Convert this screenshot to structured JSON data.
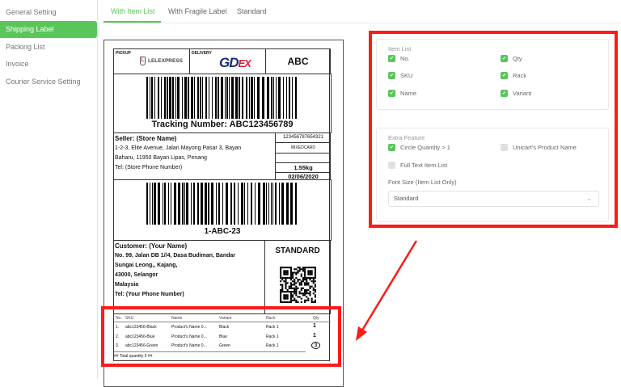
{
  "sidebar": {
    "items": [
      {
        "label": "General Setting"
      },
      {
        "label": "Shipping Label",
        "active": true
      },
      {
        "label": "Packing List"
      },
      {
        "label": "Invoice"
      },
      {
        "label": "Courier Service Setting"
      }
    ]
  },
  "tabs": [
    {
      "label": "With Item List",
      "active": true
    },
    {
      "label": "With Fragile Label"
    },
    {
      "label": "Standard"
    }
  ],
  "label": {
    "pickup_caption": "PICKUP",
    "pickup_logo": "LELEXPRESS",
    "delivery_caption": "DELIVERY",
    "delivery_logo": "GDEX",
    "code": "ABC",
    "tracking": "Tracking Number: ABC123456789",
    "seller": {
      "title": "Seller: (Store Name)",
      "line1": "1-2-3, Elite Avenue, Jalan Mayong Pasar 3, Bayan",
      "line2": "Baharu, 11950 Bayan Lipas, Penang",
      "tel": "Tel: (Store Phone Number)"
    },
    "side": {
      "number": "123456787654321",
      "type": "MIXEDCARD",
      "blank": "",
      "weight": "1.55kg",
      "date": "02/06/2020"
    },
    "sort_code": "1-ABC-23",
    "customer": {
      "title": "Customer: (Your Name)",
      "line1": "No. 99, Jalan DB 1//4, Dasa Budiman, Bandar",
      "line2": "Sungai Leong,, Kajang,",
      "line3": "43000, Selangor",
      "line4": "Malaysia",
      "tel": "Tel: (Your Phone Number)"
    },
    "service": "STANDARD",
    "items": {
      "headers": [
        "No.",
        "SKU",
        "Name",
        "Variant",
        "Rack",
        "Qty"
      ],
      "rows": [
        [
          "1.",
          "abc123456-Black",
          "Product's Name 0...",
          "Black",
          "Rack 1",
          "1"
        ],
        [
          "2.",
          "abc123456-Blue",
          "Product's Name 0...",
          "Blue",
          "Rack 1",
          "1"
        ],
        [
          "3.",
          "abc123456-Green",
          "Product's Name 0...",
          "Green",
          "Rack 1",
          "3"
        ]
      ],
      "total": "## Total quantity 5 ##"
    }
  },
  "settings": {
    "item_list": {
      "title": "Item List",
      "options": [
        {
          "label": "No.",
          "checked": true
        },
        {
          "label": "Qty",
          "checked": true
        },
        {
          "label": "SKU",
          "checked": true
        },
        {
          "label": "Rack",
          "checked": true
        },
        {
          "label": "Name",
          "checked": true
        },
        {
          "label": "Variant",
          "checked": true
        }
      ]
    },
    "extra": {
      "title": "Extra Feature",
      "options": [
        {
          "label": "Circle Quantity > 1",
          "checked": true
        },
        {
          "label": "Unicart's Product Name",
          "checked": false
        },
        {
          "label": "Full Text Item List",
          "checked": false
        }
      ],
      "font_size_label": "Font Size (Item List Only)",
      "font_size_value": "Standard"
    }
  },
  "colors": {
    "accent": "#5ac65a",
    "highlight": "#ff1a1a"
  }
}
